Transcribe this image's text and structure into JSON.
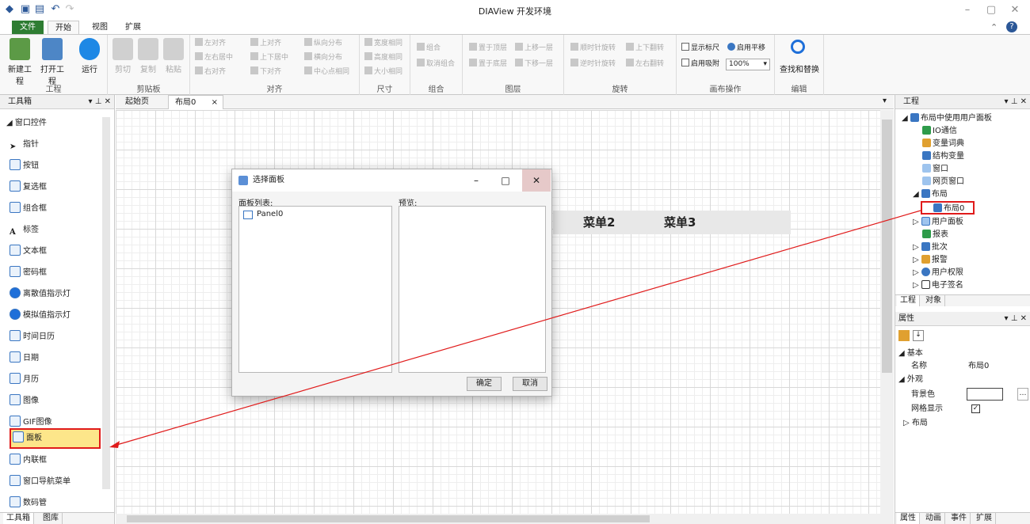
{
  "window": {
    "title": "DIAView 开发环境"
  },
  "ribbon_tabs": [
    {
      "label": "文件"
    },
    {
      "label": "开始"
    },
    {
      "label": "视图"
    },
    {
      "label": "扩展"
    }
  ],
  "ribbon": {
    "project": {
      "new": "新建工程",
      "open": "打开工程",
      "run": "运行",
      "label": "工程"
    },
    "clipboard": {
      "cut": "剪切",
      "copy": "复制",
      "paste": "粘贴",
      "label": "剪贴板"
    },
    "align": {
      "left": "左对齐",
      "hcenter": "左右居中",
      "right": "右对齐",
      "top": "上对齐",
      "vcenter": "上下居中",
      "bottom": "下对齐",
      "vdist": "纵向分布",
      "hdist": "横向分布",
      "center": "中心点相同",
      "label": "对齐"
    },
    "size": {
      "width": "宽度相同",
      "height": "高度相同",
      "both": "大小相同",
      "label": "尺寸"
    },
    "group": {
      "group": "组合",
      "ungroup": "取消组合",
      "label": "组合"
    },
    "layer": {
      "top": "置于顶层",
      "up": "上移一层",
      "bottom": "置于底层",
      "down": "下移一层",
      "label": "图层"
    },
    "rotate": {
      "cw": "顺时针旋转",
      "ccw": "逆时针旋转",
      "flipv": "上下翻转",
      "fliph": "左右翻转",
      "label": "旋转"
    },
    "canvas": {
      "ruler": "显示标尺",
      "pan": "启用平移",
      "snap": "启用吸附",
      "zoom": "100%",
      "label": "画布操作"
    },
    "edit": {
      "find": "查找和替换",
      "label": "编辑"
    }
  },
  "toolbox": {
    "title": "工具箱",
    "category": "窗口控件",
    "items": [
      "指针",
      "按钮",
      "复选框",
      "组合框",
      "标签",
      "文本框",
      "密码框",
      "离散值指示灯",
      "模拟值指示灯",
      "时间日历",
      "日期",
      "月历",
      "图像",
      "GIF图像",
      "面板",
      "内联框",
      "窗口导航菜单",
      "数码管"
    ],
    "tabs": [
      "工具箱",
      "图库"
    ]
  },
  "doc_tabs": [
    "起始页",
    "布局0"
  ],
  "canvas": {
    "menus": [
      "菜单2",
      "菜单3"
    ]
  },
  "dialog": {
    "title": "选择面板",
    "list_label": "面板列表:",
    "preview_label": "预览:",
    "panels": [
      "Panel0"
    ],
    "ok": "确定",
    "cancel": "取消"
  },
  "project_panel": {
    "title": "工程",
    "root": "布局中使用用户面板",
    "items": [
      "IO通信",
      "变量词典",
      "结构变量",
      "窗口",
      "网页窗口",
      "布局",
      "布局0",
      "用户面板",
      "报表",
      "批次",
      "报警",
      "用户权限",
      "电子签名"
    ],
    "tabs": [
      "工程",
      "对象"
    ]
  },
  "properties": {
    "title": "属性",
    "basic": "基本",
    "name_label": "名称",
    "name_value": "布局0",
    "appearance": "外观",
    "bg_label": "背景色",
    "grid_label": "网格显示",
    "layout": "布局",
    "tabs": [
      "属性",
      "动画",
      "事件",
      "扩展"
    ]
  },
  "colors": {
    "accent": "#3a76c2",
    "highlight": "#e01b1b",
    "file_tab": "#2e7d32"
  }
}
